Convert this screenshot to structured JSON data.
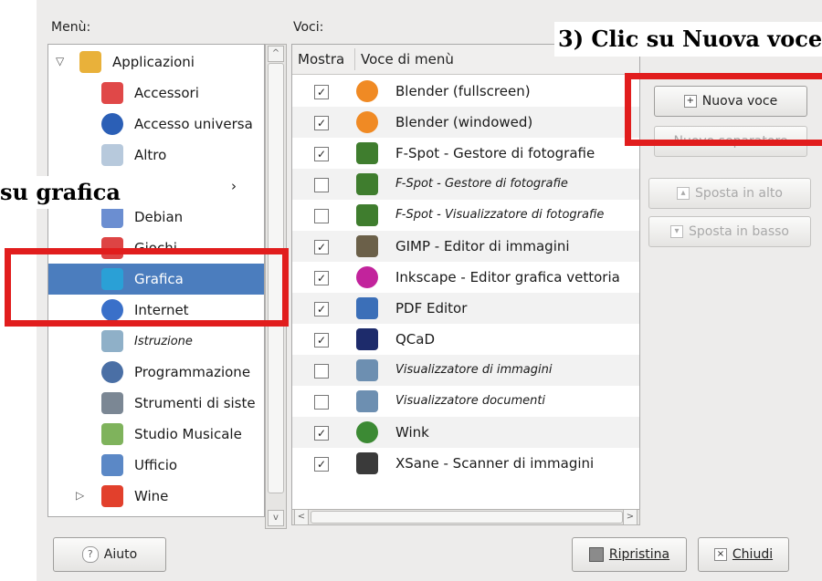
{
  "headers": {
    "menu": "Menù:",
    "items": "Voci:"
  },
  "callouts": {
    "step3": "3) Clic su Nuova voce",
    "step_left": "su grafica"
  },
  "tree": [
    {
      "label": "Applicazioni",
      "icon": "folder-icon",
      "color": "#e9b13a"
    },
    {
      "label": "Accessori",
      "icon": "accessories-icon",
      "color": "#e04848"
    },
    {
      "label": "Accesso universa",
      "icon": "accessibility-icon",
      "color": "#2b5fb6"
    },
    {
      "label": "Altro",
      "icon": "other-icon",
      "color": "#b7c9dc"
    },
    {
      "label": "›",
      "icon": "",
      "color": ""
    },
    {
      "label": "Debian",
      "icon": "debian-icon",
      "color": "#6b8ed1"
    },
    {
      "label": "Giochi",
      "icon": "games-icon",
      "color": "#d44"
    },
    {
      "label": "Grafica",
      "icon": "graphics-icon",
      "color": "#2aa0d6"
    },
    {
      "label": "Internet",
      "icon": "internet-icon",
      "color": "#3a70c9"
    },
    {
      "label": "Istruzione",
      "icon": "education-icon",
      "color": "#8fb0c8"
    },
    {
      "label": "Programmazione",
      "icon": "programming-icon",
      "color": "#4a6fa5"
    },
    {
      "label": "Strumenti di siste",
      "icon": "system-tools-icon",
      "color": "#7b8794"
    },
    {
      "label": "Studio Musicale",
      "icon": "music-icon",
      "color": "#7fb35c"
    },
    {
      "label": "Ufficio",
      "icon": "office-icon",
      "color": "#5b88c6"
    },
    {
      "label": "Wine",
      "icon": "wine-icon",
      "color": "#e2402c"
    }
  ],
  "table": {
    "col_show": "Mostra",
    "col_item": "Voce di menù",
    "rows": [
      {
        "label": "Blender (fullscreen)",
        "checked": "✓",
        "icon": "blender-icon",
        "color": "#f08a24",
        "italic": false
      },
      {
        "label": "Blender (windowed)",
        "checked": "✓",
        "icon": "blender-icon",
        "color": "#f08a24",
        "italic": false
      },
      {
        "label": "F-Spot - Gestore di fotografie",
        "checked": "✓",
        "icon": "f-spot-icon",
        "color": "#3f7d2e",
        "italic": false
      },
      {
        "label": "F-Spot - Gestore di fotografie",
        "checked": "",
        "icon": "f-spot-icon",
        "color": "#3f7d2e",
        "italic": true
      },
      {
        "label": "F-Spot - Visualizzatore di fotografie",
        "checked": "",
        "icon": "f-spot-icon",
        "color": "#3f7d2e",
        "italic": true
      },
      {
        "label": "GIMP - Editor di immagini",
        "checked": "✓",
        "icon": "gimp-icon",
        "color": "#6b6049",
        "italic": false
      },
      {
        "label": "Inkscape - Editor grafica vettoria",
        "checked": "✓",
        "icon": "inkscape-icon",
        "color": "#c2239c",
        "italic": false
      },
      {
        "label": "PDF Editor",
        "checked": "✓",
        "icon": "pdf-editor-icon",
        "color": "#3b6fb8",
        "italic": false
      },
      {
        "label": "QCaD",
        "checked": "✓",
        "icon": "qcad-icon",
        "color": "#1d2b6b",
        "italic": false
      },
      {
        "label": "Visualizzatore di immagini",
        "checked": "",
        "icon": "image-viewer-icon",
        "color": "#6d8fb1",
        "italic": true
      },
      {
        "label": "Visualizzatore documenti",
        "checked": "",
        "icon": "document-viewer-icon",
        "color": "#6d8fb1",
        "italic": true
      },
      {
        "label": "Wink",
        "checked": "✓",
        "icon": "wink-icon",
        "color": "#3c8a34",
        "italic": false
      },
      {
        "label": "XSane - Scanner di immagini",
        "checked": "✓",
        "icon": "xsane-icon",
        "color": "#3a3a3a",
        "italic": false
      }
    ]
  },
  "buttons": {
    "new_item": "Nuova voce",
    "new_separator": "Nuovo separatore",
    "move_up": "Sposta in alto",
    "move_down": "Sposta in basso",
    "help": "Aiuto",
    "revert": "Ripristina",
    "close": "Chiudi"
  },
  "annotation_color": "#e11d1d",
  "selection_color": "#4b7dbe"
}
